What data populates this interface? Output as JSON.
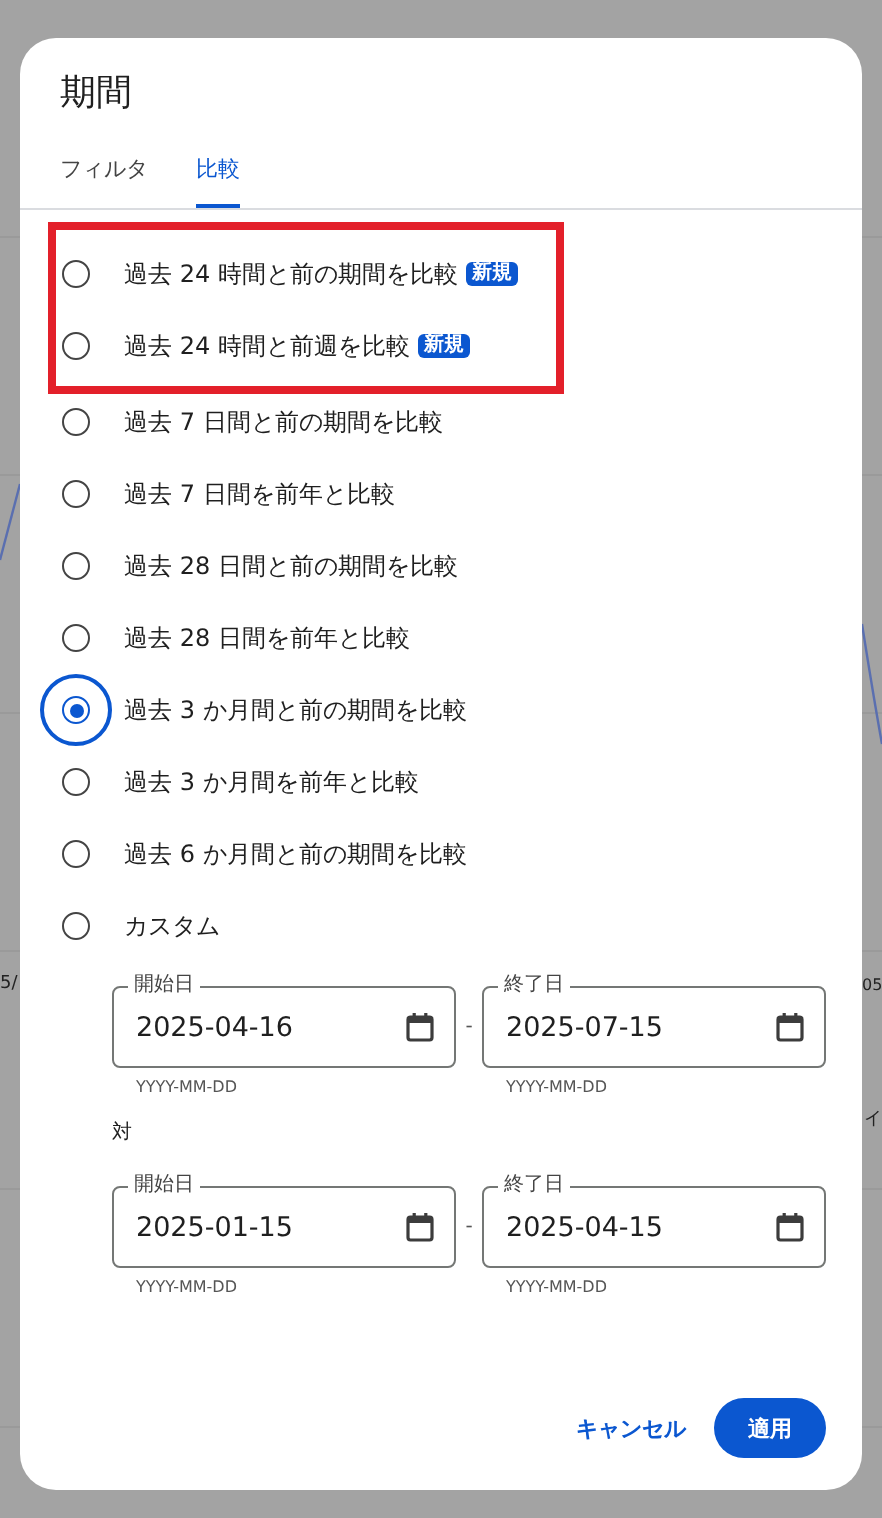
{
  "background": {
    "texts": [
      "5/",
      "05",
      "イ"
    ]
  },
  "dialog": {
    "title": "期間",
    "tabs": [
      {
        "label": "フィルタ",
        "selected": false
      },
      {
        "label": "比較",
        "selected": true
      }
    ],
    "options": [
      {
        "label": "過去 24 時間と前の期間を比較",
        "badge": "新規",
        "selected": false,
        "highlighted": true
      },
      {
        "label": "過去 24 時間と前週を比較",
        "badge": "新規",
        "selected": false,
        "highlighted": true
      },
      {
        "label": "過去 7 日間と前の期間を比較",
        "selected": false,
        "highlighted": false
      },
      {
        "label": "過去 7 日間を前年と比較",
        "selected": false,
        "highlighted": false
      },
      {
        "label": "過去 28 日間と前の期間を比較",
        "selected": false,
        "highlighted": false
      },
      {
        "label": "過去 28 日間を前年と比較",
        "selected": false,
        "highlighted": false
      },
      {
        "label": "過去 3 か月間と前の期間を比較",
        "selected": true,
        "highlighted": false
      },
      {
        "label": "過去 3 か月間を前年と比較",
        "selected": false,
        "highlighted": false
      },
      {
        "label": "過去 6 か月間と前の期間を比較",
        "selected": false,
        "highlighted": false
      },
      {
        "label": "カスタム",
        "selected": false,
        "highlighted": false
      }
    ],
    "ranges": [
      {
        "start": {
          "label": "開始日",
          "value": "2025-04-16",
          "hint": "YYYY-MM-DD"
        },
        "separator": "-",
        "end": {
          "label": "終了日",
          "value": "2025-07-15",
          "hint": "YYYY-MM-DD"
        }
      },
      {
        "start": {
          "label": "開始日",
          "value": "2025-01-15",
          "hint": "YYYY-MM-DD"
        },
        "separator": "-",
        "end": {
          "label": "終了日",
          "value": "2025-04-15",
          "hint": "YYYY-MM-DD"
        }
      }
    ],
    "versus_label": "対",
    "buttons": [
      {
        "label": "キャンセル",
        "kind": "text"
      },
      {
        "label": "適用",
        "kind": "filled"
      }
    ]
  }
}
